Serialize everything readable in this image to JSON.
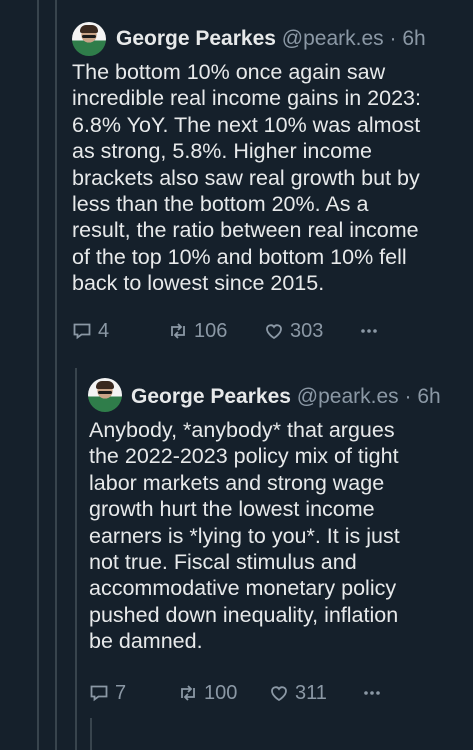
{
  "tweets": [
    {
      "author_name": "George Pearkes",
      "handle": "@peark.es",
      "separator": "·",
      "time": "6h",
      "text": "The bottom 10% once again saw\nincredible real income gains in 2023:\n6.8% YoY. The next 10% was almost\nas strong, 5.8%. Higher income\nbrackets also saw real growth but by\nless than the bottom 20%. As a\nresult, the ratio between real income\nof the top 10% and bottom 10% fell\nback to lowest since 2015.",
      "replies": "4",
      "reposts": "106",
      "likes": "303",
      "icons": [
        "reply-icon",
        "repost-icon",
        "like-icon",
        "more-icon"
      ]
    },
    {
      "author_name": "George Pearkes",
      "handle": "@peark.es",
      "separator": "·",
      "time": "6h",
      "text": "Anybody, *anybody* that argues\nthe 2022-2023 policy mix of tight\nlabor markets and strong wage\ngrowth hurt the lowest income\nearners is *lying to you*. It is just\nnot true. Fiscal stimulus and\naccommodative monetary policy\npushed down inequality, inflation\nbe damned.",
      "replies": "7",
      "reposts": "100",
      "likes": "311",
      "icons": [
        "reply-icon",
        "repost-icon",
        "like-icon",
        "more-icon"
      ]
    }
  ],
  "colors": {
    "background": "#15202b",
    "text": "#e7e9ea",
    "secondary_text": "#8b98a5",
    "thread_line": "#38444d"
  }
}
